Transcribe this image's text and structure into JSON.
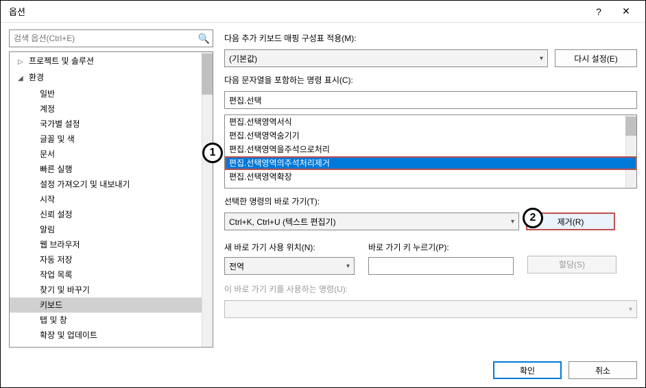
{
  "window": {
    "title": "옵션",
    "help": "?",
    "close": "✕"
  },
  "search": {
    "placeholder": "검색 옵션(Ctrl+E)"
  },
  "tree": {
    "items": [
      {
        "label": "프로젝트 및 솔루션",
        "depth": 0,
        "toggle": "▷"
      },
      {
        "label": "환경",
        "depth": 1,
        "toggle": "◢"
      },
      {
        "label": "일반",
        "depth": 2
      },
      {
        "label": "계정",
        "depth": 2
      },
      {
        "label": "국가별 설정",
        "depth": 2
      },
      {
        "label": "글꼴 및 색",
        "depth": 2
      },
      {
        "label": "문서",
        "depth": 2
      },
      {
        "label": "빠른 실행",
        "depth": 2
      },
      {
        "label": "설정 가져오기 및 내보내기",
        "depth": 2
      },
      {
        "label": "시작",
        "depth": 2
      },
      {
        "label": "신뢰 설정",
        "depth": 2
      },
      {
        "label": "알림",
        "depth": 2
      },
      {
        "label": "웹 브라우저",
        "depth": 2
      },
      {
        "label": "자동 저장",
        "depth": 2
      },
      {
        "label": "작업 목록",
        "depth": 2
      },
      {
        "label": "찾기 및 바꾸기",
        "depth": 2
      },
      {
        "label": "키보드",
        "depth": 2,
        "selected": true
      },
      {
        "label": "탭 및 창",
        "depth": 2
      },
      {
        "label": "확장 및 업데이트",
        "depth": 2
      }
    ]
  },
  "labels": {
    "mapping": "다음 추가 키보드 매핑 구성표 적용(M):",
    "commands_containing": "다음 문자열을 포함하는 명령 표시(C):",
    "selected_shortcuts": "선택한 명령의 바로 가기(T):",
    "use_in": "새 바로 가기 사용 위치(N):",
    "press_keys": "바로 가기 키 누르기(P):",
    "used_by": "이 바로 가기 키를 사용하는 명령(U):"
  },
  "mapping": {
    "value": "(기본값)",
    "reset": "다시 설정(E)"
  },
  "filter": {
    "value": "편집.선택"
  },
  "commands": [
    {
      "text": "편집.선택영역서식"
    },
    {
      "text": "편집.선택영역숨기기"
    },
    {
      "text": "편집.선택영역을주석으로처리"
    },
    {
      "text": "편집.선택영역의주석처리제거",
      "selected": true,
      "highlighted": true
    },
    {
      "text": "편집.선택영역확장"
    }
  ],
  "shortcut": {
    "value": "Ctrl+K, Ctrl+U (텍스트 편집기)",
    "remove": "제거(R)"
  },
  "newshortcut": {
    "location": "전역",
    "assign": "할당(S)"
  },
  "callouts": {
    "one": "1",
    "two": "2"
  },
  "footer": {
    "ok": "확인",
    "cancel": "취소"
  }
}
